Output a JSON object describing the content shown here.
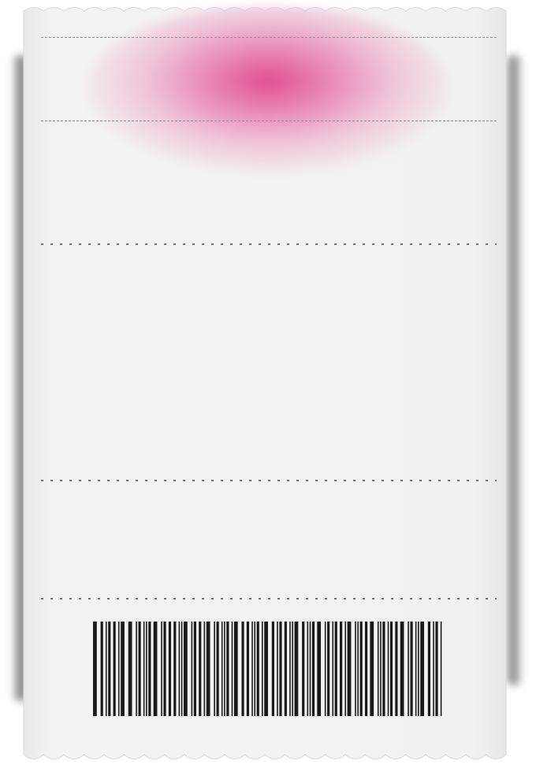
{
  "ticket": {
    "paper_color": "#efeff1",
    "accent_color": "#e0468c",
    "barcode_color": "#1a1a1a",
    "barcode_pattern": [
      3,
      2,
      1,
      2,
      2,
      1,
      3,
      3,
      1,
      2,
      1,
      1,
      2,
      3,
      1,
      2,
      2,
      2,
      1,
      1,
      3,
      1,
      2,
      2,
      1,
      3,
      1,
      2,
      1,
      1,
      2,
      1,
      3,
      2,
      2,
      1,
      1,
      2,
      1,
      3,
      2,
      1,
      2,
      2,
      1,
      1,
      3,
      2,
      1,
      1,
      2,
      3,
      1,
      2,
      1,
      2,
      2,
      1,
      3,
      1,
      1,
      2,
      2,
      3,
      1,
      1,
      2,
      1,
      2,
      2,
      3,
      1,
      2,
      1,
      1,
      3,
      2,
      1,
      2,
      1
    ]
  }
}
